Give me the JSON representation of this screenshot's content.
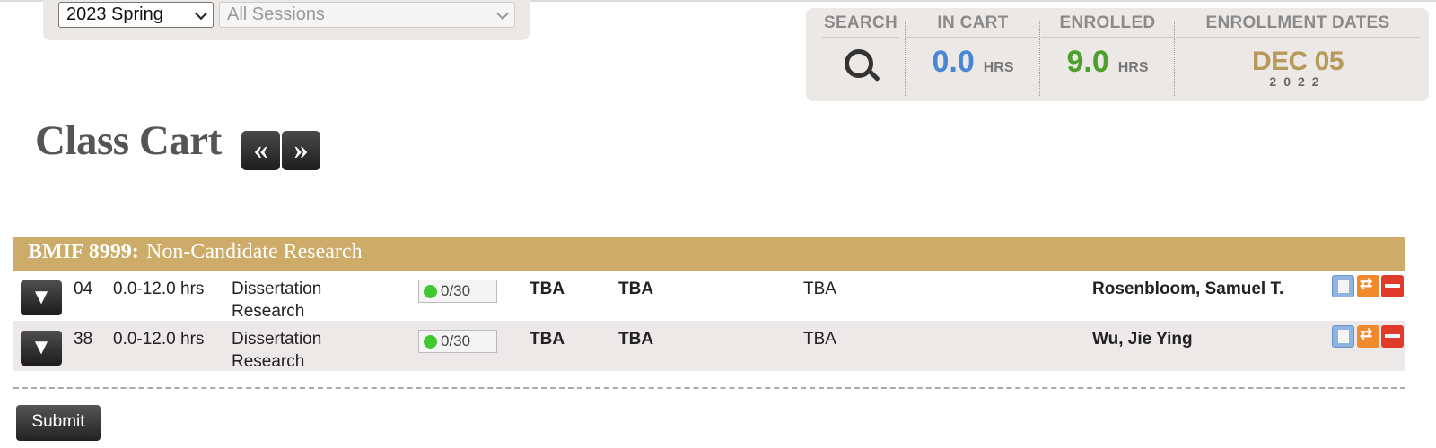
{
  "term_select": {
    "value": "2023 Spring"
  },
  "session_select": {
    "value": "All Sessions"
  },
  "stats": {
    "search_label": "SEARCH",
    "in_cart_label": "IN CART",
    "in_cart_value": "0.0",
    "in_cart_unit": "HRS",
    "enrolled_label": "ENROLLED",
    "enrolled_value": "9.0",
    "enrolled_unit": "HRS",
    "dates_label": "ENROLLMENT DATES",
    "date_main": "DEC 05",
    "date_year": "2022",
    "colors": {
      "in_cart": "#4a86d6",
      "enrolled": "#4ea02c",
      "date": "#b69a5a"
    }
  },
  "heading": {
    "title": "Class Cart",
    "prev": "«",
    "next": "»"
  },
  "course": {
    "code": "BMIF 8999:",
    "title": "Non-Candidate Research",
    "bar_color": "#cdab68"
  },
  "rows": [
    {
      "section": "04",
      "hours": "0.0-12.0 hrs",
      "type_line1": "Dissertation",
      "type_line2": "Research",
      "seats": "0/30",
      "days": "TBA",
      "time": "TBA",
      "location": "TBA",
      "instructor": "Rosenbloom, Samuel T."
    },
    {
      "section": "38",
      "hours": "0.0-12.0 hrs",
      "type_line1": "Dissertation",
      "type_line2": "Research",
      "seats": "0/30",
      "days": "TBA",
      "time": "TBA",
      "location": "TBA",
      "instructor": "Wu, Jie Ying"
    }
  ],
  "submit_label": "Submit",
  "icons": {
    "search": "magnifier-icon",
    "expand": "triangle-down-icon",
    "edit": "edit-note-icon",
    "swap": "swap-icon",
    "drop": "remove-icon"
  }
}
